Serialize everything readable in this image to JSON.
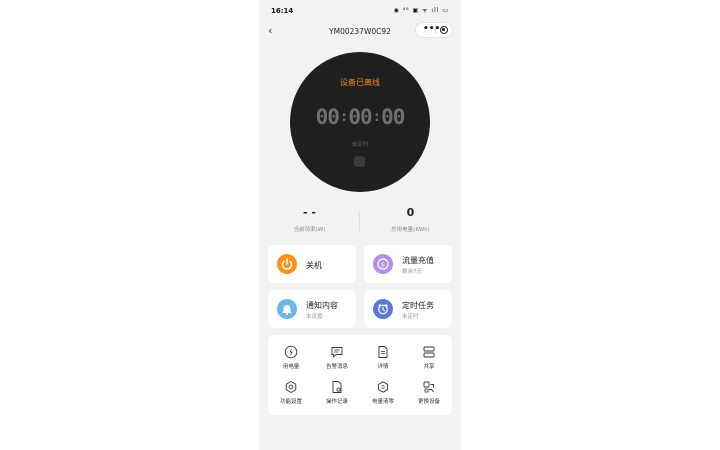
{
  "status_bar": {
    "time": "16:14",
    "icons_text": "◉ ⁴⁶ ▣ ᯤ ıll ▭"
  },
  "nav": {
    "back_glyph": "‹",
    "title": "YM00237W0C92",
    "more_glyph": "•••"
  },
  "dial": {
    "status_text": "设备已离线",
    "hours": "00",
    "minutes": "00",
    "seconds": "00",
    "colon": ":",
    "subtext": "未定时"
  },
  "stats": [
    {
      "value": "- -",
      "label": "当前功率(W)"
    },
    {
      "value": "0",
      "label": "总用电量(KWh)"
    }
  ],
  "cards": {
    "power": {
      "title": "关机",
      "icon": "power-icon",
      "color": "#f5931e"
    },
    "topup": {
      "title": "流量充值",
      "sub": "剩余7天",
      "icon": "currency-icon",
      "color": "#b28fe2"
    },
    "notify": {
      "title": "通知内容",
      "sub": "未设置",
      "icon": "bell-icon",
      "color": "#6fb6e8"
    },
    "timer": {
      "title": "定时任务",
      "sub": "未定时",
      "icon": "alarm-clock-icon",
      "color": "#5b77db"
    }
  },
  "tools": [
    {
      "label": "用电量",
      "icon": "lightning-icon"
    },
    {
      "label": "告警消息",
      "icon": "message-icon"
    },
    {
      "label": "详情",
      "icon": "document-icon"
    },
    {
      "label": "共享",
      "icon": "share-icon"
    },
    {
      "label": "功能设置",
      "icon": "hexagon-settings-icon"
    },
    {
      "label": "操作记录",
      "icon": "record-icon"
    },
    {
      "label": "电量清零",
      "icon": "reset-icon"
    },
    {
      "label": "更换设备",
      "icon": "swap-device-icon"
    }
  ],
  "colors": {
    "accent_orange": "#f08a1c",
    "dial_bg": "#1f1f1f",
    "page_bg": "#f2f2f2"
  }
}
